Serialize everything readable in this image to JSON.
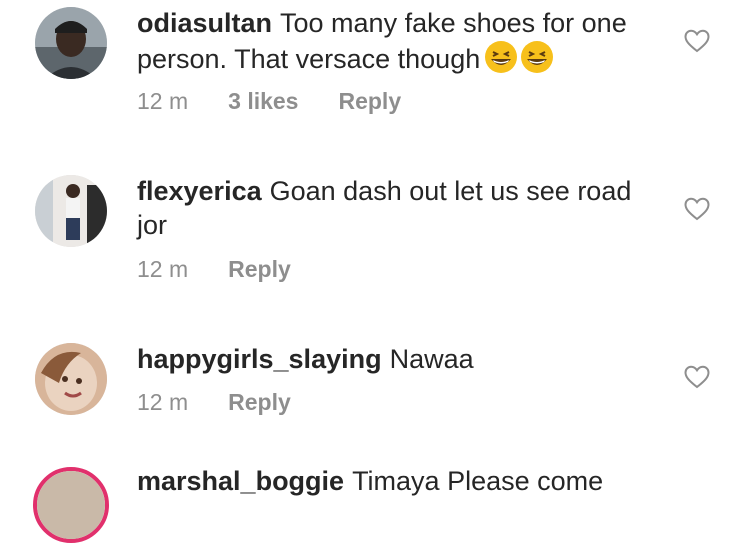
{
  "comments": [
    {
      "username": "odiasultan",
      "text": "Too many fake shoes for one person. That versace though",
      "emoji": "grinning-squinting-face x2",
      "time": "12 m",
      "likes": "3 likes",
      "reply": "Reply"
    },
    {
      "username": "flexyerica",
      "text": "Goan dash out let us see road jor",
      "time": "12 m",
      "reply": "Reply"
    },
    {
      "username": "happygirls_slaying",
      "text": "Nawaa",
      "time": "12 m",
      "reply": "Reply"
    },
    {
      "username": "marshal_boggie",
      "text": "Timaya Please come"
    }
  ],
  "icons": {
    "like": "heart-outline-icon",
    "emoji": "grinning-squinting-face"
  },
  "colors": {
    "text": "#262626",
    "meta": "#8e8e8e",
    "story_ring": "#e1306c"
  }
}
